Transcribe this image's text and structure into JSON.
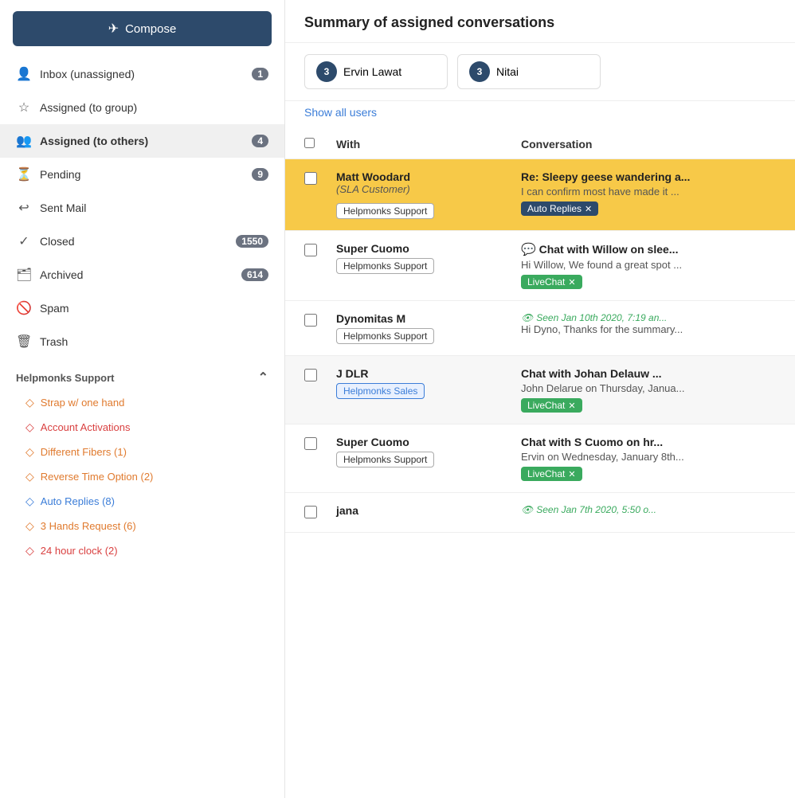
{
  "sidebar": {
    "compose_label": "Compose",
    "nav_items": [
      {
        "id": "inbox",
        "icon": "👤",
        "label": "Inbox (unassigned)",
        "badge": "1"
      },
      {
        "id": "assigned-group",
        "icon": "☆",
        "label": "Assigned (to group)",
        "badge": null
      },
      {
        "id": "assigned-others",
        "icon": "👥",
        "label": "Assigned (to others)",
        "badge": "4",
        "active": true
      },
      {
        "id": "pending",
        "icon": "⏳",
        "label": "Pending",
        "badge": "9"
      },
      {
        "id": "sent",
        "icon": "↩",
        "label": "Sent Mail",
        "badge": null
      },
      {
        "id": "closed",
        "icon": "✓",
        "label": "Closed",
        "badge": "1550"
      },
      {
        "id": "archived",
        "icon": "🗂",
        "label": "Archived",
        "badge": "614"
      },
      {
        "id": "spam",
        "icon": "🚫",
        "label": "Spam",
        "badge": null
      },
      {
        "id": "trash",
        "icon": "🗑",
        "label": "Trash",
        "badge": null
      }
    ],
    "section_label": "Helpmonks Support",
    "labels": [
      {
        "id": "strap",
        "text": "Strap w/ one hand",
        "color": "orange"
      },
      {
        "id": "account",
        "text": "Account Activations",
        "color": "red"
      },
      {
        "id": "fibers",
        "text": "Different Fibers (1)",
        "color": "orange"
      },
      {
        "id": "reverse",
        "text": "Reverse Time Option (2)",
        "color": "orange"
      },
      {
        "id": "autoreplies",
        "text": "Auto Replies (8)",
        "color": "blue"
      },
      {
        "id": "3hands",
        "text": "3 Hands Request (6)",
        "color": "orange"
      },
      {
        "id": "24hour",
        "text": "24 hour clock (2)",
        "color": "red"
      }
    ]
  },
  "main": {
    "title": "Summary of assigned conversations",
    "agents": [
      {
        "id": "ervin",
        "initials": "3",
        "name": "Ervin Lawat"
      },
      {
        "id": "nitai",
        "initials": "3",
        "name": "Nitai"
      }
    ],
    "show_all_label": "Show all users",
    "table": {
      "col_with": "With",
      "col_conv": "Conversation",
      "rows": [
        {
          "id": "row1",
          "highlighted": true,
          "contact_name": "Matt Woodard",
          "contact_type": "(SLA Customer)",
          "tag": "Helpmonks Support",
          "conv_title": "Re: Sleepy geese wandering a...",
          "conv_preview": "I can confirm most have made it ...",
          "label": "Auto Replies",
          "label_style": "dark",
          "has_chat_icon": false
        },
        {
          "id": "row2",
          "highlighted": false,
          "contact_name": "Super Cuomo",
          "contact_type": null,
          "tag": "Helpmonks Support",
          "conv_title": null,
          "conv_preview": "Hi Willow, We found a great spot ...",
          "label": "LiveChat",
          "label_style": "green",
          "has_chat_icon": true,
          "chat_text": "Chat with Willow on slee..."
        },
        {
          "id": "row3",
          "highlighted": false,
          "contact_name": "Dynomitas M",
          "contact_type": null,
          "tag": "Helpmonks Support",
          "conv_title": null,
          "conv_preview": "Hi Dyno, Thanks for the summary...",
          "label": null,
          "label_style": null,
          "has_chat_icon": false,
          "seen_text": "Seen Jan 10th 2020, 7:19 an..."
        },
        {
          "id": "row4",
          "highlighted": false,
          "alt_bg": true,
          "contact_name": "J DLR",
          "contact_type": null,
          "tag": "Helpmonks Sales",
          "tag_style": "sales",
          "conv_title": "Chat with Johan Delauw ...",
          "conv_preview": "John Delarue on Thursday, Janua...",
          "label": "LiveChat",
          "label_style": "green",
          "has_chat_icon": true
        },
        {
          "id": "row5",
          "highlighted": false,
          "contact_name": "Super Cuomo",
          "contact_type": null,
          "tag": "Helpmonks Support",
          "conv_title": "Chat with S Cuomo on hr...",
          "conv_preview": "Ervin on Wednesday, January 8th...",
          "label": "LiveChat",
          "label_style": "green",
          "has_chat_icon": true
        },
        {
          "id": "row6",
          "highlighted": false,
          "contact_name": "jana",
          "contact_type": null,
          "tag": null,
          "conv_title": null,
          "conv_preview": null,
          "label": null,
          "label_style": null,
          "has_chat_icon": false,
          "seen_text": "Seen Jan 7th 2020, 5:50 o..."
        }
      ]
    }
  }
}
